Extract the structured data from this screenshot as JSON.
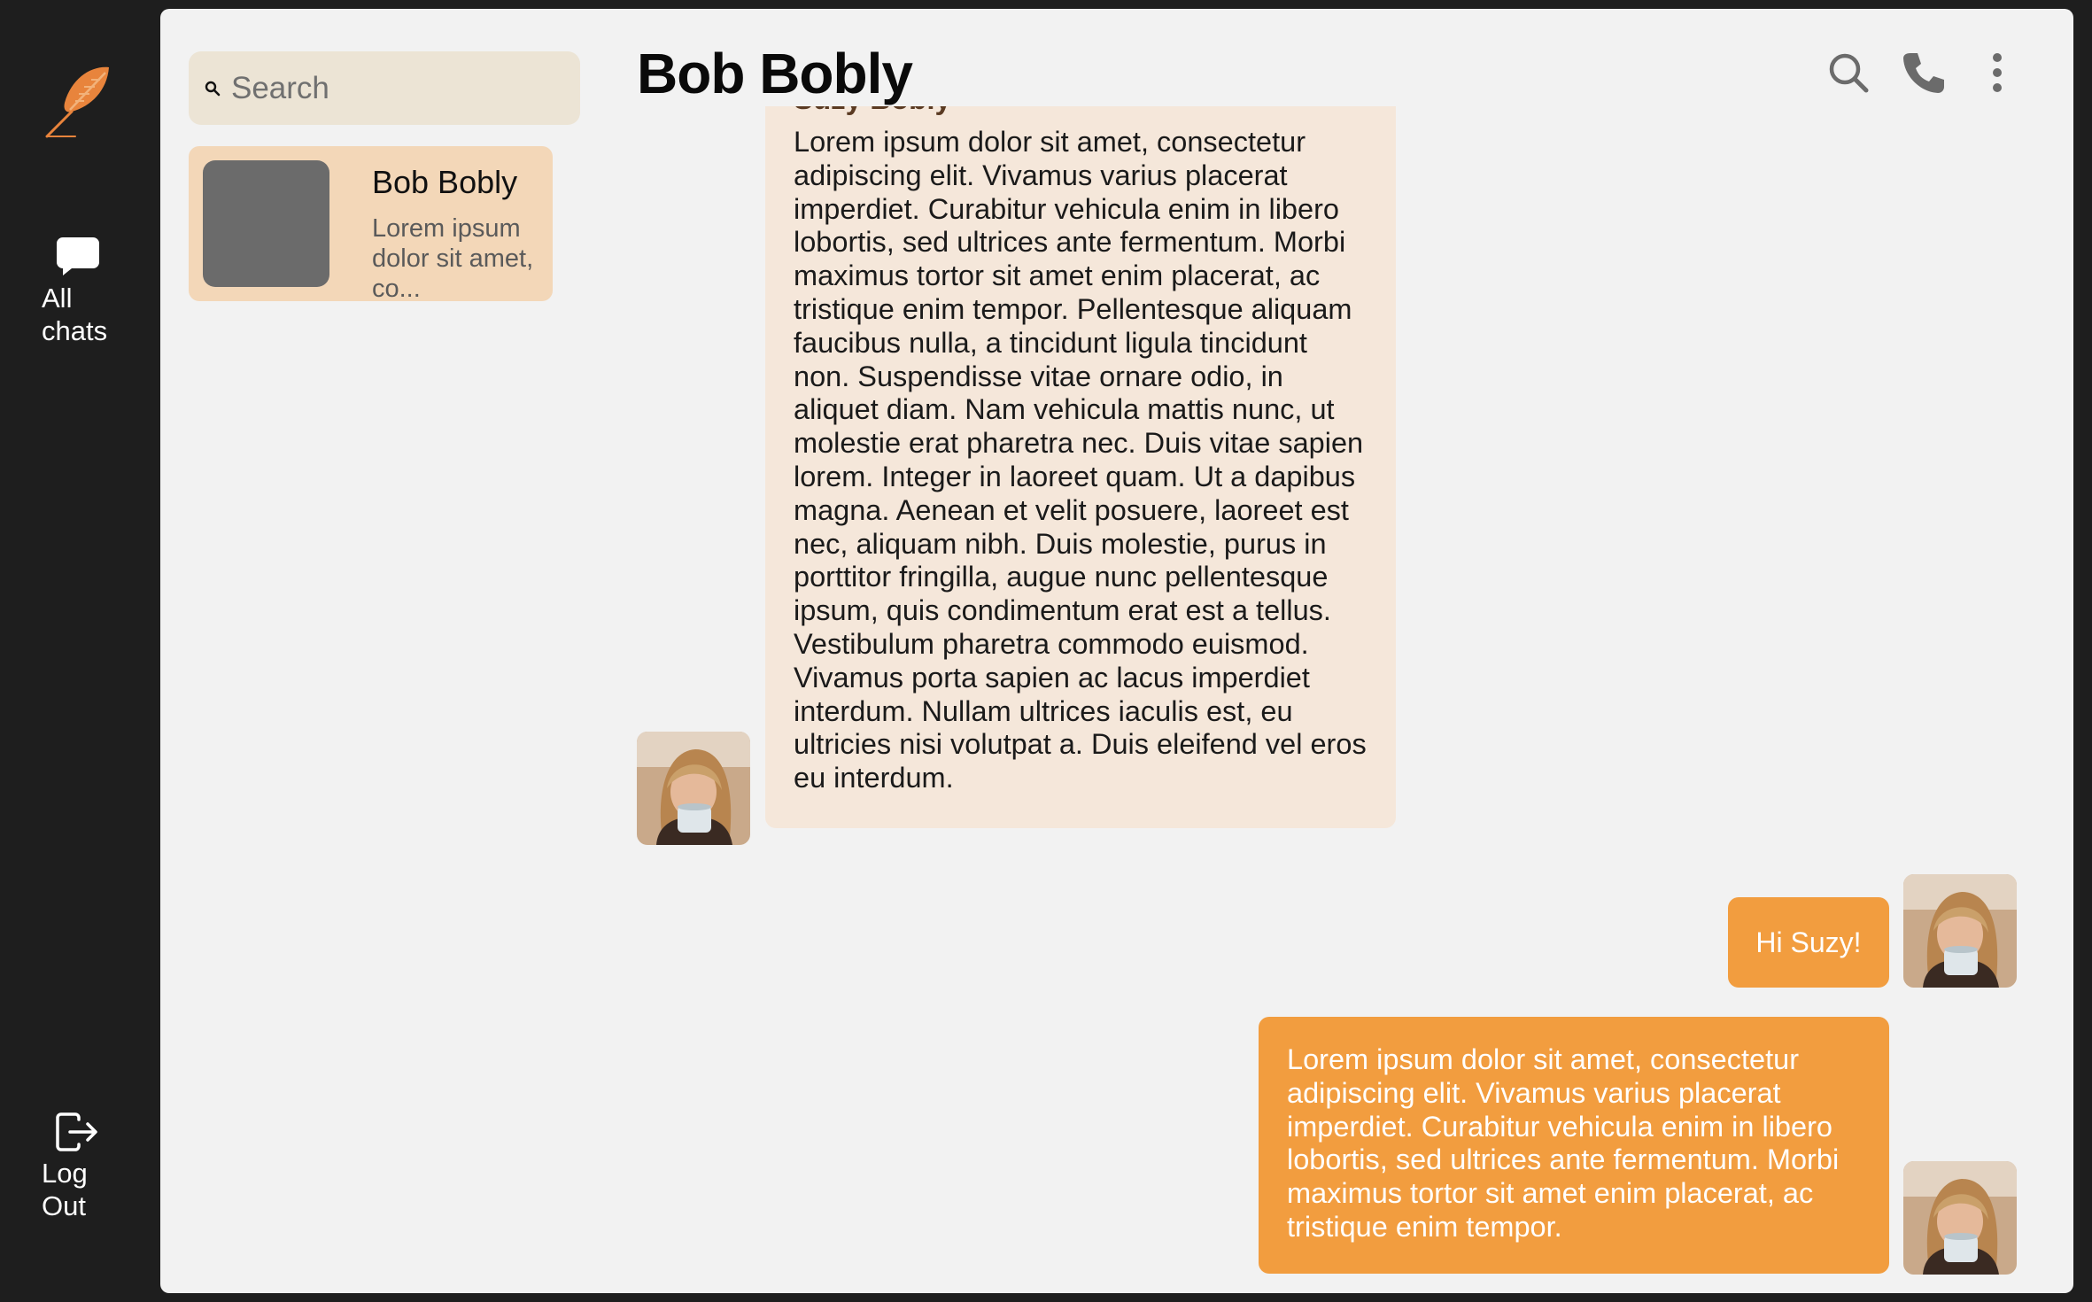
{
  "sidebar": {
    "logo_icon": "feather-logo-icon",
    "accent_color": "#e8843c",
    "all_chats_label": "All\nchats",
    "logout_label": "Log\nOut"
  },
  "chat_list": {
    "search_placeholder": "Search",
    "items": [
      {
        "name": "Bob Bobly",
        "preview": "Lorem ipsum dolor sit amet, co..."
      }
    ]
  },
  "conversation": {
    "title": "Bob Bobly",
    "header_icons": [
      "search-icon",
      "phone-icon",
      "more-vertical-icon"
    ],
    "messages": [
      {
        "direction": "incoming",
        "sender": "Suzy Bobly",
        "text": "Lorem ipsum dolor sit amet, consectetur adipiscing elit. Vivamus varius placerat imperdiet. Curabitur vehicula enim in libero lobortis, sed ultrices ante fermentum. Morbi maximus tortor sit amet enim placerat, ac tristique enim tempor. Pellentesque aliquam faucibus nulla, a tincidunt ligula tincidunt non. Suspendisse vitae ornare odio, in aliquet diam. Nam vehicula mattis nunc, ut molestie erat pharetra nec. Duis vitae sapien lorem. Integer in laoreet quam. Ut a dapibus magna. Aenean et velit posuere, laoreet est nec, aliquam nibh. Duis molestie, purus in porttitor fringilla, augue nunc pellentesque ipsum, quis condimentum erat est a tellus. Vestibulum pharetra commodo euismod. Vivamus porta sapien ac lacus imperdiet interdum. Nullam ultrices iaculis est, eu ultricies nisi volutpat a. Duis eleifend vel eros eu interdum."
      },
      {
        "direction": "outgoing",
        "text": "Hi Suzy!"
      },
      {
        "direction": "outgoing",
        "text": "Lorem ipsum dolor sit amet, consectetur adipiscing elit. Vivamus varius placerat imperdiet. Curabitur vehicula enim in libero lobortis, sed ultrices ante fermentum. Morbi maximus tortor sit amet enim placerat, ac tristique enim tempor."
      }
    ]
  },
  "colors": {
    "rail_bg": "#1e1e1e",
    "panel_bg": "#f2f2f2",
    "search_bg": "#ece4d5",
    "active_chat_bg": "#f3d7b8",
    "incoming_bubble_bg": "#f5e7da",
    "outgoing_bubble_bg": "#f29d3f"
  }
}
